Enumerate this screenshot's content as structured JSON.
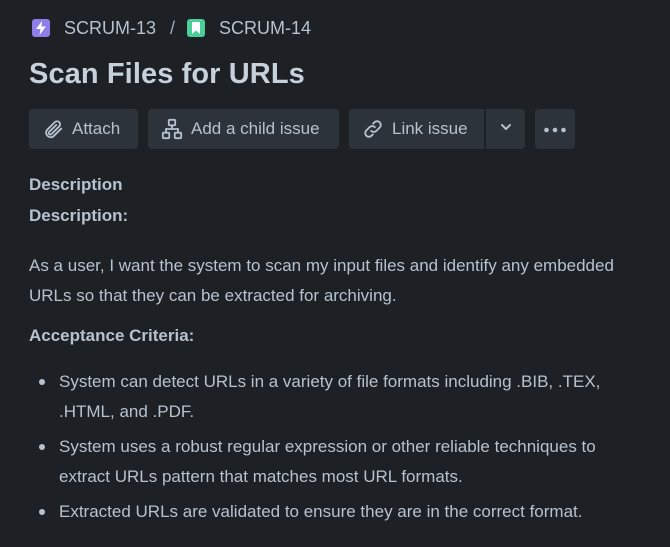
{
  "breadcrumb": {
    "parent": {
      "key": "SCRUM-13",
      "icon": "epic-lightning-icon",
      "color": "#8f7ee7"
    },
    "separator": "/",
    "current": {
      "key": "SCRUM-14",
      "icon": "story-bookmark-icon",
      "color": "#4bce97"
    }
  },
  "issue": {
    "title": "Scan Files for URLs"
  },
  "toolbar": {
    "attach_label": "Attach",
    "child_issue_label": "Add a child issue",
    "link_issue_label": "Link issue"
  },
  "description": {
    "section_label": "Description",
    "subheading": "Description:",
    "paragraph_line1": "As a user, I want the system to scan my input files and identify any embedded",
    "paragraph_line2": "URLs so that they can be extracted for archiving.",
    "acceptance_heading": "Acceptance Criteria:",
    "criteria": [
      {
        "line1": "System can detect URLs in a variety of file formats including .BIB, .TEX,",
        "line2": ".HTML, and .PDF."
      },
      {
        "line1": "System uses a robust regular expression or other reliable techniques to",
        "line2": "extract URLs pattern that matches most URL formats."
      },
      {
        "line1": "Extracted URLs are validated to ensure they are in the correct format.",
        "line2": ""
      }
    ]
  },
  "colors": {
    "background": "#1d2125",
    "button_bg": "#2c333a",
    "text": "#b6c2cf"
  }
}
